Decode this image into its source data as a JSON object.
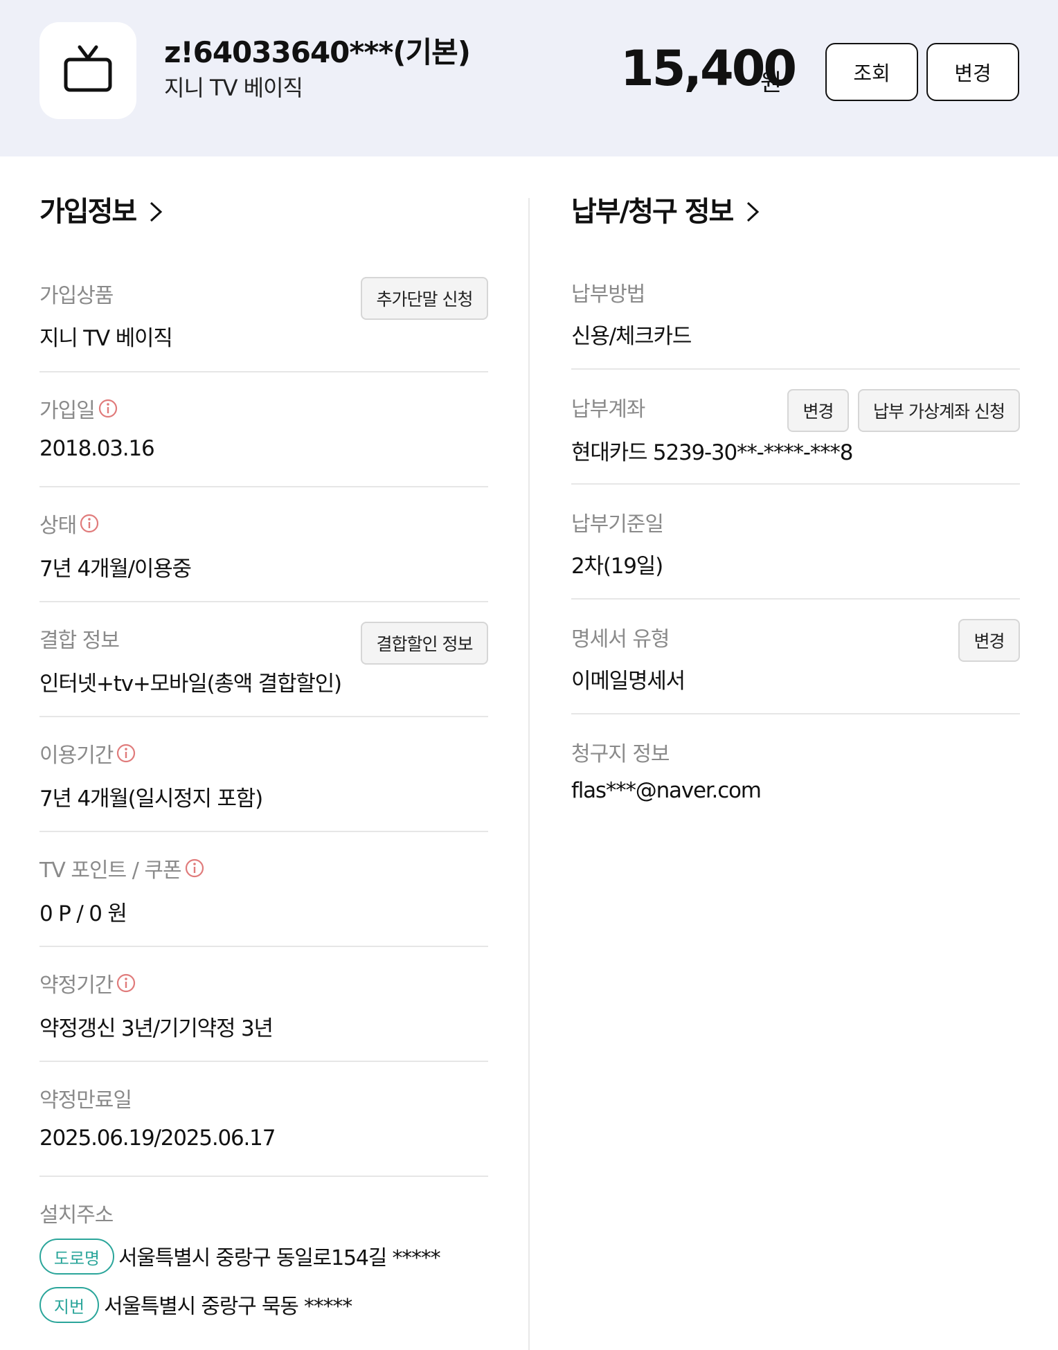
{
  "header": {
    "account_id": "z!64033640***(기본)",
    "plan_name": "지니 TV 베이직",
    "price": "15,400",
    "price_unit": "원",
    "inquiry_button": "조회",
    "change_button": "변경",
    "icon": "tv-icon"
  },
  "subscription": {
    "title": "가입정보",
    "product": {
      "label": "가입상품",
      "value": "지니 TV 베이직",
      "button": "추가단말 신청"
    },
    "join_date": {
      "label": "가입일",
      "value": "2018.03.16"
    },
    "status": {
      "label": "상태",
      "value": "7년 4개월/이용중"
    },
    "bundle": {
      "label": "결합 정보",
      "value": "인터넷+tv+모바일(총액 결합할인)",
      "button": "결합할인 정보"
    },
    "usage_period": {
      "label": "이용기간",
      "value": "7년 4개월(일시정지 포함)"
    },
    "points": {
      "label": "TV 포인트 / 쿠폰",
      "value": "0 P / 0 원"
    },
    "contract": {
      "label": "약정기간",
      "value": "약정갱신 3년/기기약정 3년"
    },
    "contract_end": {
      "label": "약정만료일",
      "value": "2025.06.19/2025.06.17"
    },
    "address": {
      "label": "설치주소",
      "road_tag": "도로명",
      "road_value": "서울특별시 중랑구 동일로154길 *****",
      "lot_tag": "지번",
      "lot_value": "서울특별시 중랑구 묵동 *****"
    }
  },
  "billing": {
    "title": "납부/청구 정보",
    "method": {
      "label": "납부방법",
      "value": "신용/체크카드"
    },
    "account": {
      "label": "납부계좌",
      "value": "현대카드 5239-30**-****-***8",
      "change_button": "변경",
      "virtual_button": "납부 가상계좌 신청"
    },
    "due_date": {
      "label": "납부기준일",
      "value": "2차(19일)"
    },
    "statement": {
      "label": "명세서 유형",
      "value": "이메일명세서",
      "change_button": "변경"
    },
    "billing_address": {
      "label": "청구지 정보",
      "value": "flas***@naver.com"
    }
  },
  "colors": {
    "header_bg": "#eef0f8",
    "accent_teal": "#2aa59a",
    "title_highlight": "#c9f0ec",
    "info_icon": "#e07b7b"
  }
}
